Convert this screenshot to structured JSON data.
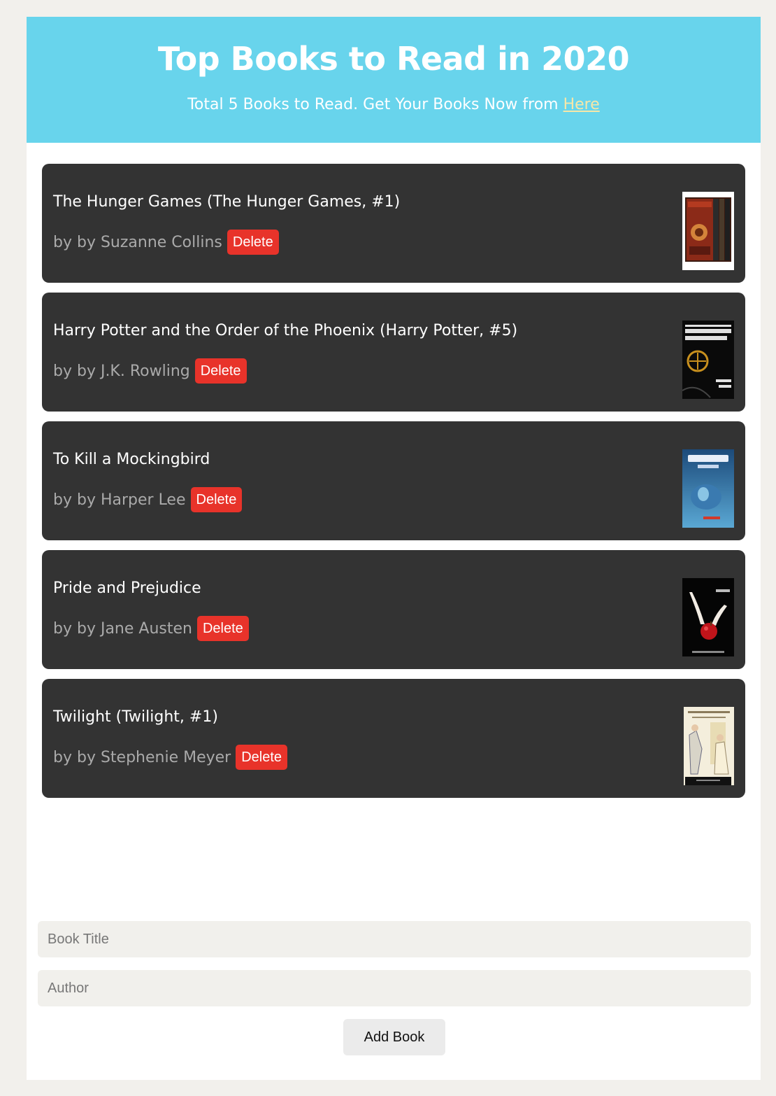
{
  "header": {
    "title": "Top Books to Read in 2020",
    "subtitle_text": "Total 5 Books to Read. Get Your Books Now from ",
    "link_label": "Here",
    "background_color": "#68d4ec",
    "link_color": "#f6e7a8"
  },
  "books": [
    {
      "title": "The Hunger Games (The Hunger Games, #1)",
      "author": "by by Suzanne Collins",
      "delete_label": "Delete",
      "cover": "box-set-cover"
    },
    {
      "title": "Harry Potter and the Order of the Phoenix (Harry Potter, #5)",
      "author": "by by J.K. Rowling",
      "delete_label": "Delete",
      "cover": "hunger-games-cover"
    },
    {
      "title": "To Kill a Mockingbird",
      "author": "by by Harper Lee",
      "delete_label": "Delete",
      "cover": "harry-potter-cover"
    },
    {
      "title": "Pride and Prejudice",
      "author": "by by Jane Austen",
      "delete_label": "Delete",
      "cover": "twilight-cover"
    },
    {
      "title": "Twilight (Twilight, #1)",
      "author": "by by Stephenie Meyer",
      "delete_label": "Delete",
      "cover": "pride-prejudice-cover"
    }
  ],
  "form": {
    "title_placeholder": "Book Title",
    "author_placeholder": "Author",
    "add_label": "Add Book"
  },
  "colors": {
    "card_bg": "#333333",
    "delete_bg": "#e8332a"
  }
}
